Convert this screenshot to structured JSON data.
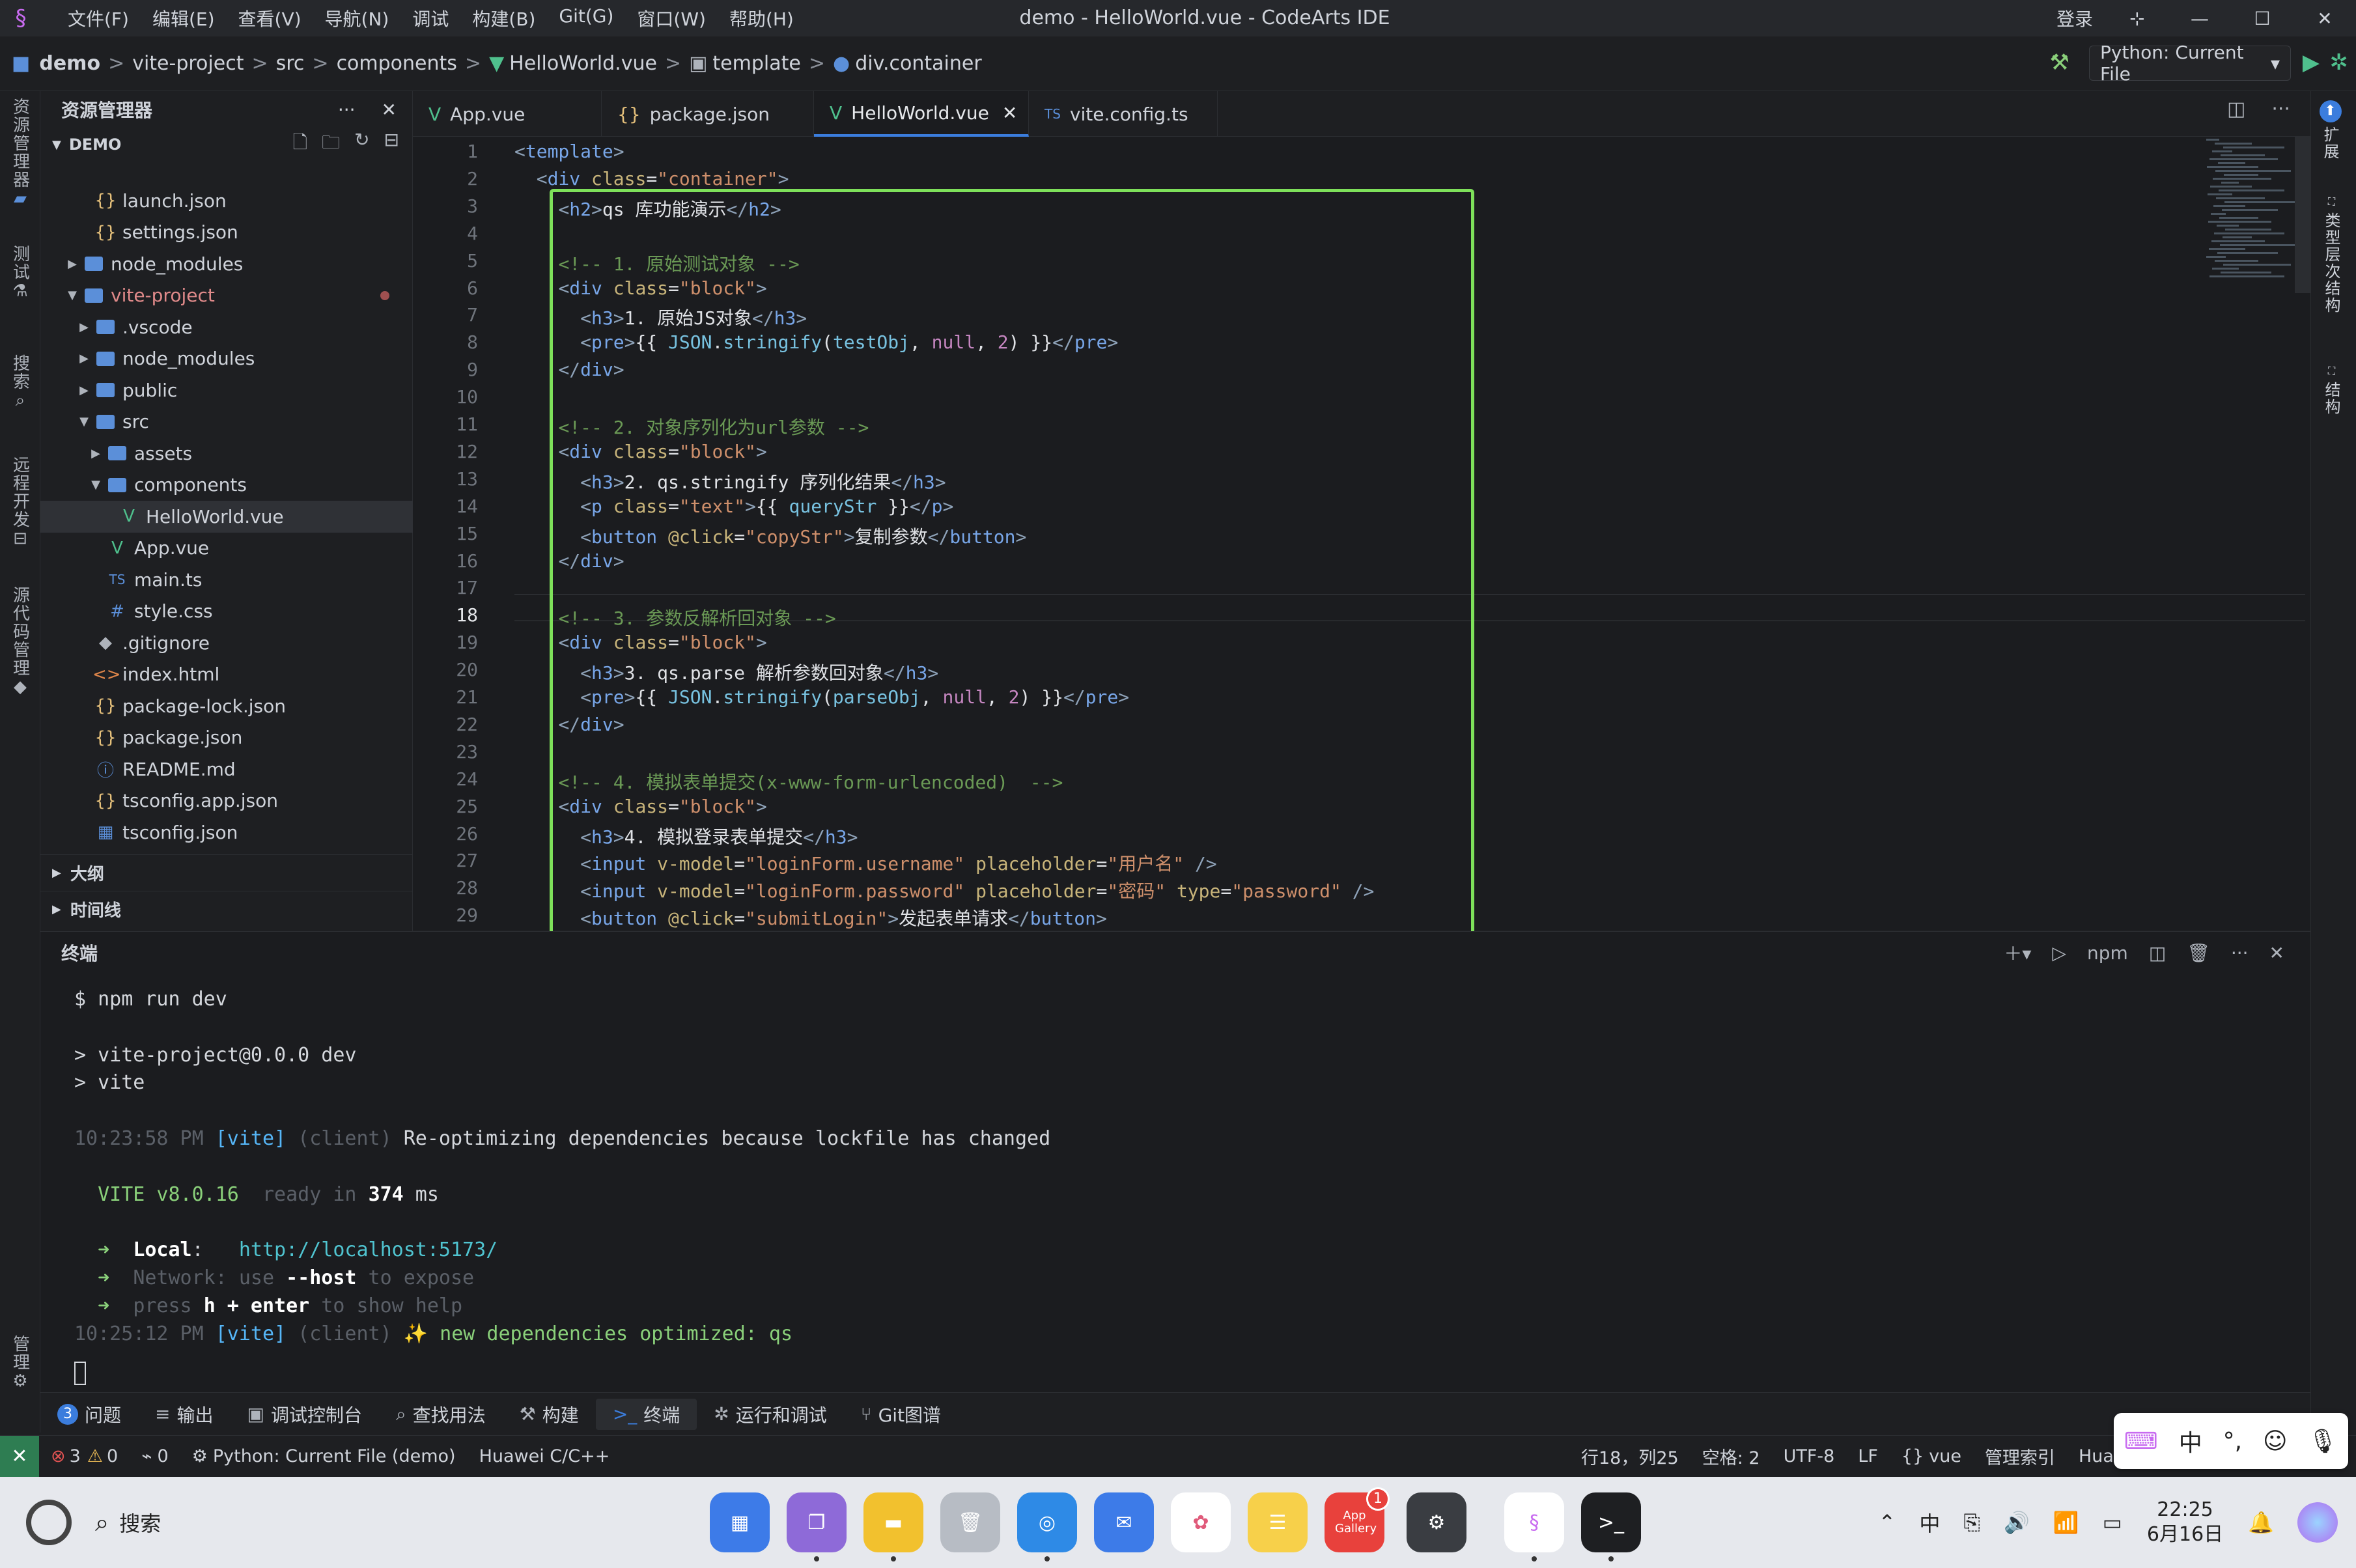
{
  "titlebar": {
    "menus": [
      "文件(F)",
      "编辑(E)",
      "查看(V)",
      "导航(N)",
      "调试",
      "构建(B)",
      "Git(G)",
      "窗口(W)",
      "帮助(H)"
    ],
    "window_title": "demo - HelloWorld.vue - CodeArts IDE",
    "login": "登录"
  },
  "breadcrumb": {
    "items": [
      "demo",
      "vite-project",
      "src",
      "components",
      "HelloWorld.vue",
      "template",
      "div.container"
    ],
    "run_config": "Python: Current File"
  },
  "activity": {
    "items": [
      "资源管理器",
      "测试",
      "搜索",
      "远程开发",
      "源代码管理",
      "管理"
    ]
  },
  "rightbar": {
    "items": [
      "扩展",
      "类型层次结构",
      "结构"
    ]
  },
  "explorer": {
    "title": "资源管理器",
    "root": "DEMO",
    "tree": [
      {
        "label": "launch.json",
        "icon": "{}",
        "indent": 1,
        "type": "file"
      },
      {
        "label": "settings.json",
        "icon": "{}",
        "indent": 1,
        "type": "file"
      },
      {
        "label": "node_modules",
        "icon": "folder",
        "indent": 0,
        "type": "folder-closed"
      },
      {
        "label": "vite-project",
        "icon": "folder",
        "indent": 0,
        "type": "folder-open"
      },
      {
        "label": ".vscode",
        "icon": "folder",
        "indent": 1,
        "type": "folder-closed"
      },
      {
        "label": "node_modules",
        "icon": "folder",
        "indent": 1,
        "type": "folder-closed"
      },
      {
        "label": "public",
        "icon": "folder",
        "indent": 1,
        "type": "folder-closed"
      },
      {
        "label": "src",
        "icon": "folder",
        "indent": 1,
        "type": "folder-open"
      },
      {
        "label": "assets",
        "icon": "folder",
        "indent": 2,
        "type": "folder-closed"
      },
      {
        "label": "components",
        "icon": "folder",
        "indent": 2,
        "type": "folder-open"
      },
      {
        "label": "HelloWorld.vue",
        "icon": "V",
        "indent": 3,
        "type": "file",
        "selected": true
      },
      {
        "label": "App.vue",
        "icon": "V",
        "indent": 2,
        "type": "file"
      },
      {
        "label": "main.ts",
        "icon": "TS",
        "indent": 2,
        "type": "file"
      },
      {
        "label": "style.css",
        "icon": "#",
        "indent": 2,
        "type": "file"
      },
      {
        "label": ".gitignore",
        "icon": "◆",
        "indent": 1,
        "type": "file"
      },
      {
        "label": "index.html",
        "icon": "<>",
        "indent": 1,
        "type": "file"
      },
      {
        "label": "package-lock.json",
        "icon": "{}",
        "indent": 1,
        "type": "file"
      },
      {
        "label": "package.json",
        "icon": "{}",
        "indent": 1,
        "type": "file"
      },
      {
        "label": "README.md",
        "icon": "ⓘ",
        "indent": 1,
        "type": "file"
      },
      {
        "label": "tsconfig.app.json",
        "icon": "{}",
        "indent": 1,
        "type": "file"
      },
      {
        "label": "tsconfig.json",
        "icon": "▦",
        "indent": 1,
        "type": "file"
      }
    ],
    "sections": [
      "大纲",
      "时间线"
    ]
  },
  "tabs": [
    {
      "label": "App.vue",
      "icon": "V"
    },
    {
      "label": "package.json",
      "icon": "{}"
    },
    {
      "label": "HelloWorld.vue",
      "icon": "V",
      "active": true
    },
    {
      "label": "vite.config.ts",
      "icon": "TS"
    }
  ],
  "editor": {
    "current_line": 18,
    "lines": [
      [
        [
          "tg",
          "<"
        ],
        [
          "tn",
          "template"
        ],
        [
          "tg",
          ">"
        ]
      ],
      [
        [
          "tx",
          "  "
        ],
        [
          "tg",
          "<"
        ],
        [
          "tn",
          "div"
        ],
        [
          "tx",
          " "
        ],
        [
          "at",
          "class"
        ],
        [
          "tx",
          "="
        ],
        [
          "sv",
          "\"container\""
        ],
        [
          "tg",
          ">"
        ]
      ],
      [
        [
          "tx",
          "    "
        ],
        [
          "tg",
          "<"
        ],
        [
          "tn",
          "h2"
        ],
        [
          "tg",
          ">"
        ],
        [
          "tx",
          "qs 库功能演示"
        ],
        [
          "tg",
          "</"
        ],
        [
          "tn",
          "h2"
        ],
        [
          "tg",
          ">"
        ]
      ],
      [],
      [
        [
          "tx",
          "    "
        ],
        [
          "cm",
          "<!-- 1. 原始测试对象 -->"
        ]
      ],
      [
        [
          "tx",
          "    "
        ],
        [
          "tg",
          "<"
        ],
        [
          "tn",
          "div"
        ],
        [
          "tx",
          " "
        ],
        [
          "at",
          "class"
        ],
        [
          "tx",
          "="
        ],
        [
          "sv",
          "\"block\""
        ],
        [
          "tg",
          ">"
        ]
      ],
      [
        [
          "tx",
          "      "
        ],
        [
          "tg",
          "<"
        ],
        [
          "tn",
          "h3"
        ],
        [
          "tg",
          ">"
        ],
        [
          "tx",
          "1. 原始JS对象"
        ],
        [
          "tg",
          "</"
        ],
        [
          "tn",
          "h3"
        ],
        [
          "tg",
          ">"
        ]
      ],
      [
        [
          "tx",
          "      "
        ],
        [
          "tg",
          "<"
        ],
        [
          "tn",
          "pre"
        ],
        [
          "tg",
          ">"
        ],
        [
          "tx",
          "{{ "
        ],
        [
          "cj",
          "JSON"
        ],
        [
          "tx",
          "."
        ],
        [
          "cj",
          "stringify"
        ],
        [
          "tx",
          "("
        ],
        [
          "cj",
          "testObj"
        ],
        [
          "tx",
          ", "
        ],
        [
          "cn",
          "null"
        ],
        [
          "tx",
          ", "
        ],
        [
          "cn",
          "2"
        ],
        [
          "tx",
          ") }}"
        ],
        [
          "tg",
          "</"
        ],
        [
          "tn",
          "pre"
        ],
        [
          "tg",
          ">"
        ]
      ],
      [
        [
          "tx",
          "    "
        ],
        [
          "tg",
          "</"
        ],
        [
          "tn",
          "div"
        ],
        [
          "tg",
          ">"
        ]
      ],
      [],
      [
        [
          "tx",
          "    "
        ],
        [
          "cm",
          "<!-- 2. 对象序列化为url参数 -->"
        ]
      ],
      [
        [
          "tx",
          "    "
        ],
        [
          "tg",
          "<"
        ],
        [
          "tn",
          "div"
        ],
        [
          "tx",
          " "
        ],
        [
          "at",
          "class"
        ],
        [
          "tx",
          "="
        ],
        [
          "sv",
          "\"block\""
        ],
        [
          "tg",
          ">"
        ]
      ],
      [
        [
          "tx",
          "      "
        ],
        [
          "tg",
          "<"
        ],
        [
          "tn",
          "h3"
        ],
        [
          "tg",
          ">"
        ],
        [
          "tx",
          "2. qs.stringify 序列化结果"
        ],
        [
          "tg",
          "</"
        ],
        [
          "tn",
          "h3"
        ],
        [
          "tg",
          ">"
        ]
      ],
      [
        [
          "tx",
          "      "
        ],
        [
          "tg",
          "<"
        ],
        [
          "tn",
          "p"
        ],
        [
          "tx",
          " "
        ],
        [
          "at",
          "class"
        ],
        [
          "tx",
          "="
        ],
        [
          "sv",
          "\"text\""
        ],
        [
          "tg",
          ">"
        ],
        [
          "tx",
          "{{ "
        ],
        [
          "cj",
          "queryStr"
        ],
        [
          "tx",
          " }}"
        ],
        [
          "tg",
          "</"
        ],
        [
          "tn",
          "p"
        ],
        [
          "tg",
          ">"
        ]
      ],
      [
        [
          "tx",
          "      "
        ],
        [
          "tg",
          "<"
        ],
        [
          "tn",
          "button"
        ],
        [
          "tx",
          " "
        ],
        [
          "at",
          "@click"
        ],
        [
          "tx",
          "="
        ],
        [
          "sv",
          "\"copyStr\""
        ],
        [
          "tg",
          ">"
        ],
        [
          "tx",
          "复制参数"
        ],
        [
          "tg",
          "</"
        ],
        [
          "tn",
          "button"
        ],
        [
          "tg",
          ">"
        ]
      ],
      [
        [
          "tx",
          "    "
        ],
        [
          "tg",
          "</"
        ],
        [
          "tn",
          "div"
        ],
        [
          "tg",
          ">"
        ]
      ],
      [],
      [
        [
          "tx",
          "    "
        ],
        [
          "cm",
          "<!-- 3. 参数反解析回对象 -->"
        ]
      ],
      [
        [
          "tx",
          "    "
        ],
        [
          "tg",
          "<"
        ],
        [
          "tn",
          "div"
        ],
        [
          "tx",
          " "
        ],
        [
          "at",
          "class"
        ],
        [
          "tx",
          "="
        ],
        [
          "sv",
          "\"block\""
        ],
        [
          "tg",
          ">"
        ]
      ],
      [
        [
          "tx",
          "      "
        ],
        [
          "tg",
          "<"
        ],
        [
          "tn",
          "h3"
        ],
        [
          "tg",
          ">"
        ],
        [
          "tx",
          "3. qs.parse 解析参数回对象"
        ],
        [
          "tg",
          "</"
        ],
        [
          "tn",
          "h3"
        ],
        [
          "tg",
          ">"
        ]
      ],
      [
        [
          "tx",
          "      "
        ],
        [
          "tg",
          "<"
        ],
        [
          "tn",
          "pre"
        ],
        [
          "tg",
          ">"
        ],
        [
          "tx",
          "{{ "
        ],
        [
          "cj",
          "JSON"
        ],
        [
          "tx",
          "."
        ],
        [
          "cj",
          "stringify"
        ],
        [
          "tx",
          "("
        ],
        [
          "cj",
          "parseObj"
        ],
        [
          "tx",
          ", "
        ],
        [
          "cn",
          "null"
        ],
        [
          "tx",
          ", "
        ],
        [
          "cn",
          "2"
        ],
        [
          "tx",
          ") }}"
        ],
        [
          "tg",
          "</"
        ],
        [
          "tn",
          "pre"
        ],
        [
          "tg",
          ">"
        ]
      ],
      [
        [
          "tx",
          "    "
        ],
        [
          "tg",
          "</"
        ],
        [
          "tn",
          "div"
        ],
        [
          "tg",
          ">"
        ]
      ],
      [],
      [
        [
          "tx",
          "    "
        ],
        [
          "cm",
          "<!-- 4. 模拟表单提交(x-www-form-urlencoded)  -->"
        ]
      ],
      [
        [
          "tx",
          "    "
        ],
        [
          "tg",
          "<"
        ],
        [
          "tn",
          "div"
        ],
        [
          "tx",
          " "
        ],
        [
          "at",
          "class"
        ],
        [
          "tx",
          "="
        ],
        [
          "sv",
          "\"block\""
        ],
        [
          "tg",
          ">"
        ]
      ],
      [
        [
          "tx",
          "      "
        ],
        [
          "tg",
          "<"
        ],
        [
          "tn",
          "h3"
        ],
        [
          "tg",
          ">"
        ],
        [
          "tx",
          "4. 模拟登录表单提交"
        ],
        [
          "tg",
          "</"
        ],
        [
          "tn",
          "h3"
        ],
        [
          "tg",
          ">"
        ]
      ],
      [
        [
          "tx",
          "      "
        ],
        [
          "tg",
          "<"
        ],
        [
          "tn",
          "input"
        ],
        [
          "tx",
          " "
        ],
        [
          "at",
          "v-model"
        ],
        [
          "tx",
          "="
        ],
        [
          "sv",
          "\"loginForm.username\""
        ],
        [
          "tx",
          " "
        ],
        [
          "at",
          "placeholder"
        ],
        [
          "tx",
          "="
        ],
        [
          "sv",
          "\"用户名\""
        ],
        [
          "tx",
          " "
        ],
        [
          "tg",
          "/>"
        ]
      ],
      [
        [
          "tx",
          "      "
        ],
        [
          "tg",
          "<"
        ],
        [
          "tn",
          "input"
        ],
        [
          "tx",
          " "
        ],
        [
          "at",
          "v-model"
        ],
        [
          "tx",
          "="
        ],
        [
          "sv",
          "\"loginForm.password\""
        ],
        [
          "tx",
          " "
        ],
        [
          "at",
          "placeholder"
        ],
        [
          "tx",
          "="
        ],
        [
          "sv",
          "\"密码\""
        ],
        [
          "tx",
          " "
        ],
        [
          "at",
          "type"
        ],
        [
          "tx",
          "="
        ],
        [
          "sv",
          "\"password\""
        ],
        [
          "tx",
          " "
        ],
        [
          "tg",
          "/>"
        ]
      ],
      [
        [
          "tx",
          "      "
        ],
        [
          "tg",
          "<"
        ],
        [
          "tn",
          "button"
        ],
        [
          "tx",
          " "
        ],
        [
          "at",
          "@click"
        ],
        [
          "tx",
          "="
        ],
        [
          "sv",
          "\"submitLogin\""
        ],
        [
          "tg",
          ">"
        ],
        [
          "tx",
          "发起表单请求"
        ],
        [
          "tg",
          "</"
        ],
        [
          "tn",
          "button"
        ],
        [
          "tg",
          ">"
        ]
      ]
    ]
  },
  "terminal": {
    "title": "终端",
    "shell_label": "npm",
    "lines": [
      [
        [
          "n",
          "$ npm run dev"
        ]
      ],
      [],
      [
        [
          "n",
          "> vite-project@0.0.0 dev"
        ]
      ],
      [
        [
          "n",
          "> vite"
        ]
      ],
      [],
      [
        [
          "tdim",
          "10:23:58 PM "
        ],
        [
          "tvite",
          "[vite]"
        ],
        [
          "tdim",
          " (client) "
        ],
        [
          "n",
          "Re-optimizing dependencies because lockfile has changed"
        ]
      ],
      [],
      [
        [
          "n",
          "  "
        ],
        [
          "tgreen",
          "VITE"
        ],
        [
          "tgreen",
          " v8.0.16"
        ],
        [
          "tdim",
          "  ready in "
        ],
        [
          "tbold",
          "374"
        ],
        [
          "n",
          " ms"
        ]
      ],
      [],
      [
        [
          "n",
          "  "
        ],
        [
          "tgreen",
          "➜"
        ],
        [
          "n",
          "  "
        ],
        [
          "tbold",
          "Local"
        ],
        [
          "n",
          ":   "
        ],
        [
          "tcyan",
          "http://localhost:5173/"
        ]
      ],
      [
        [
          "n",
          "  "
        ],
        [
          "tgreen",
          "➜"
        ],
        [
          "n",
          "  "
        ],
        [
          "tdim",
          "Network"
        ],
        [
          "tdim",
          ": use "
        ],
        [
          "tbold",
          "--host"
        ],
        [
          "tdim",
          " to expose"
        ]
      ],
      [
        [
          "n",
          "  "
        ],
        [
          "tgreen",
          "➜"
        ],
        [
          "n",
          "  "
        ],
        [
          "tdim",
          "press "
        ],
        [
          "tbold",
          "h + enter"
        ],
        [
          "tdim",
          " to show help"
        ]
      ],
      [
        [
          "tdim",
          "10:25:12 PM "
        ],
        [
          "tvite",
          "[vite]"
        ],
        [
          "tdim",
          " (client) "
        ],
        [
          "tgreen",
          "✨ new dependencies optimized: "
        ],
        [
          "tgreen",
          "qs"
        ]
      ]
    ]
  },
  "panel_tabs": [
    {
      "label": "问题",
      "badge": "3"
    },
    {
      "label": "输出"
    },
    {
      "label": "调试控制台"
    },
    {
      "label": "查找用法"
    },
    {
      "label": "构建"
    },
    {
      "label": "终端",
      "active": true
    },
    {
      "label": "运行和调试"
    },
    {
      "label": "Git图谱"
    }
  ],
  "statusbar": {
    "errors": "3",
    "warnings": "0",
    "ports": "0",
    "python": "Python: Current File (demo)",
    "lang_server": "Huawei C/C++",
    "position": "行18，列25",
    "spaces": "空格: 2",
    "encoding": "UTF-8",
    "eol": "LF",
    "language": "vue",
    "index": "管理索引",
    "right_trunc": "Huawei C"
  },
  "ime": {
    "lang": "中",
    "punct": "°,"
  },
  "taskbar": {
    "search": "搜索",
    "appgallery_badge": "1",
    "appgallery_label": "App Gallery",
    "time": "22:25",
    "date": "6月16日"
  },
  "colors": {
    "accent": "#3b7ddd",
    "highlight": "#7ee05a",
    "remote": "#2e7d52"
  }
}
